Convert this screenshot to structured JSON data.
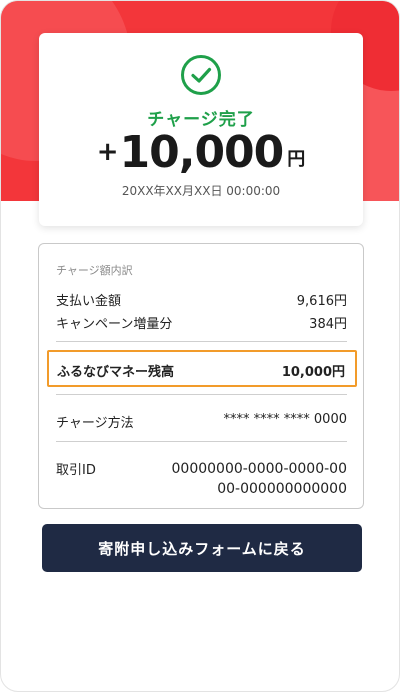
{
  "success": {
    "status": "チャージ完了",
    "amount_plus": "+",
    "amount": "10,000",
    "amount_unit": "円",
    "timestamp": "20XX年XX月XX日 00:00:00"
  },
  "details": {
    "section_label": "チャージ額内訳",
    "payment_label": "支払い金額",
    "payment_value": "9,616円",
    "campaign_label": "キャンペーン増量分",
    "campaign_value": "384円",
    "balance_label": "ふるなびマネー残高",
    "balance_value": "10,000円",
    "method_label": "チャージ方法",
    "method_value": "**** **** **** 0000",
    "txid_label": "取引ID",
    "txid_line1": "00000000-0000-0000-00",
    "txid_line2": "00-000000000000"
  },
  "button": {
    "back_label": "寄附申し込みフォームに戻る"
  },
  "colors": {
    "brand_red": "#f3363a",
    "success_green": "#1fa04a",
    "highlight_orange": "#f29b2a",
    "button_navy": "#1f2a44"
  }
}
